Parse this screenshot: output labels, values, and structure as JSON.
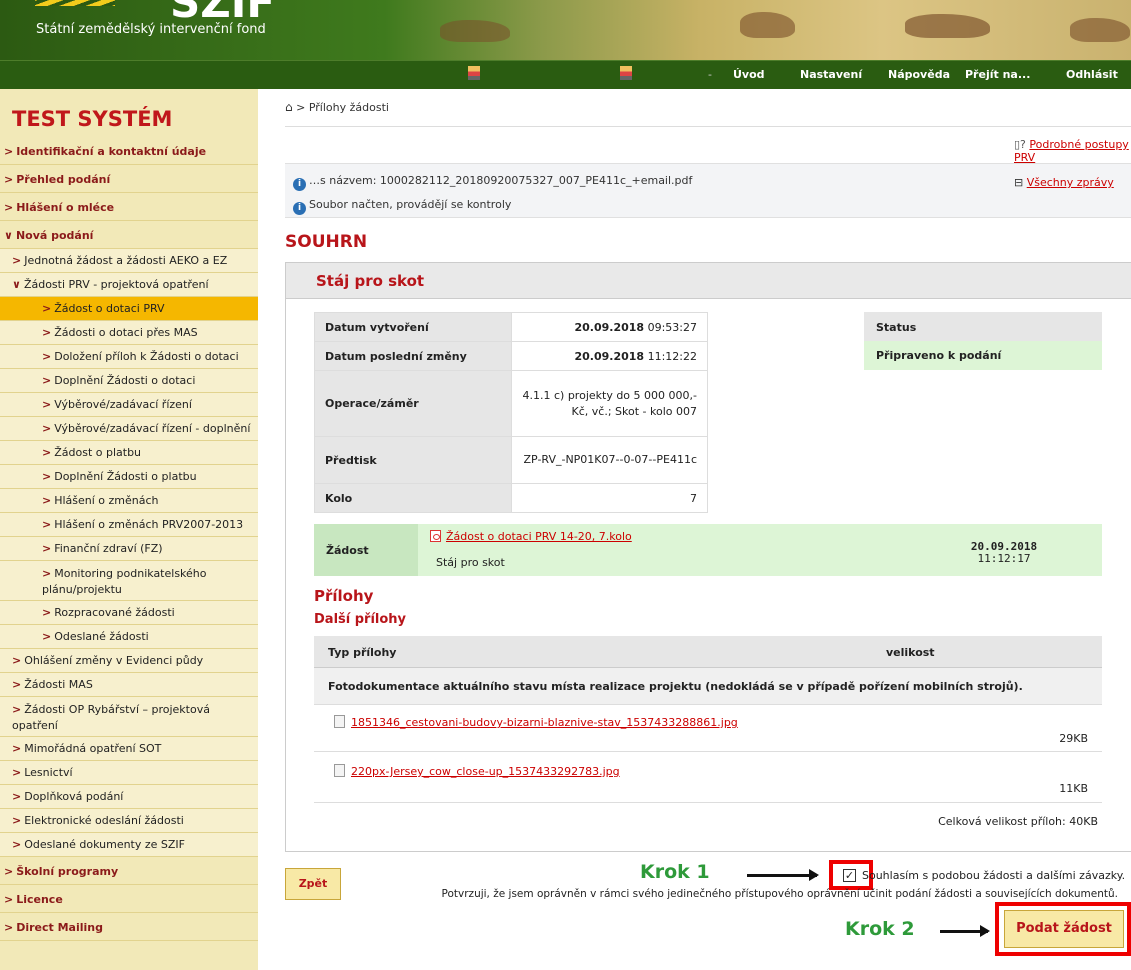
{
  "header": {
    "subtitle": "Státní zemědělský intervenční fond",
    "logo": "SZIF"
  },
  "nav": {
    "items": [
      "Úvod",
      "Nastavení",
      "Nápověda",
      "Přejít na...",
      "Odhlásit"
    ]
  },
  "sidebar": {
    "system_title": "TEST SYSTÉM",
    "items": [
      {
        "label": "Identifikační a kontaktní údaje",
        "level": 1,
        "arrow": ">"
      },
      {
        "label": "Přehled podání",
        "level": 1,
        "arrow": ">"
      },
      {
        "label": "Hlášení o mléce",
        "level": 1,
        "arrow": ">"
      },
      {
        "label": "Nová podání",
        "level": 1,
        "arrow": "∨"
      },
      {
        "label": "Jednotná žádost a žádosti AEKO a EZ",
        "level": 2,
        "arrow": ">"
      },
      {
        "label": "Žádosti PRV - projektová opatření",
        "level": 2,
        "arrow": "∨"
      },
      {
        "label": "Žádost o dotaci PRV",
        "level": 3,
        "arrow": ">",
        "active": true
      },
      {
        "label": "Žádosti o dotaci přes MAS",
        "level": 3,
        "arrow": ">"
      },
      {
        "label": "Doložení příloh k Žádosti o dotaci",
        "level": 3,
        "arrow": ">"
      },
      {
        "label": "Doplnění Žádosti o dotaci",
        "level": 3,
        "arrow": ">"
      },
      {
        "label": "Výběrové/zadávací řízení",
        "level": 3,
        "arrow": ">"
      },
      {
        "label": "Výběrové/zadávací řízení - doplnění",
        "level": 3,
        "arrow": ">"
      },
      {
        "label": "Žádost o platbu",
        "level": 3,
        "arrow": ">"
      },
      {
        "label": "Doplnění Žádosti o platbu",
        "level": 3,
        "arrow": ">"
      },
      {
        "label": "Hlášení o změnách",
        "level": 3,
        "arrow": ">"
      },
      {
        "label": "Hlášení o změnách PRV2007-2013",
        "level": 3,
        "arrow": ">"
      },
      {
        "label": "Finanční zdraví (FZ)",
        "level": 3,
        "arrow": ">"
      },
      {
        "label": "Monitoring podnikatelského plánu/projektu",
        "level": 3,
        "arrow": ">",
        "tall": true
      },
      {
        "label": "Rozpracované žádosti",
        "level": 3,
        "arrow": ">"
      },
      {
        "label": "Odeslané žádosti",
        "level": 3,
        "arrow": ">"
      },
      {
        "label": "Ohlášení změny v Evidenci půdy",
        "level": 2,
        "arrow": ">"
      },
      {
        "label": "Žádosti MAS",
        "level": 2,
        "arrow": ">"
      },
      {
        "label": "Žádosti OP Rybářství – projektová opatření",
        "level": 2,
        "arrow": ">",
        "tall": true
      },
      {
        "label": "Mimořádná opatření SOT",
        "level": 2,
        "arrow": ">"
      },
      {
        "label": "Lesnictví",
        "level": 2,
        "arrow": ">"
      },
      {
        "label": "Doplňková podání",
        "level": 2,
        "arrow": ">"
      },
      {
        "label": "Elektronické odeslání žádosti",
        "level": 2,
        "arrow": ">"
      },
      {
        "label": "Odeslané dokumenty ze SZIF",
        "level": 2,
        "arrow": ">"
      },
      {
        "label": "Školní programy",
        "level": 1,
        "arrow": ">"
      },
      {
        "label": "Licence",
        "level": 1,
        "arrow": ">"
      },
      {
        "label": "Direct Mailing",
        "level": 1,
        "arrow": ">"
      }
    ]
  },
  "breadcrumb": {
    "current": "Přílohy žádosti",
    "sep": ">"
  },
  "help_link": "Podrobné postupy PRV",
  "messages": [
    {
      "text": "…s názvem: 1000282112_20180920075327_007_PE411c_+email.pdf"
    },
    {
      "text": "Soubor načten, provádějí se kontroly"
    }
  ],
  "all_messages_link": "Všechny zprávy",
  "all_messages_icon": "⊟",
  "page_title": "SOUHRN",
  "panel_title": "Stáj pro skot",
  "details": [
    {
      "key": "Datum vytvoření",
      "value_bold": "20.09.2018",
      "value": " 09:53:27"
    },
    {
      "key": "Datum poslední změny",
      "value_bold": "20.09.2018",
      "value": " 11:12:22"
    },
    {
      "key": "Operace/záměr",
      "value": "4.1.1 c) projekty do 5 000 000,- Kč, vč.; Skot - kolo 007"
    },
    {
      "key": "Předtisk",
      "value": "ZP-RV_-NP01K07--0-07--PE411c"
    },
    {
      "key": "Kolo",
      "value": "7"
    }
  ],
  "status": {
    "header": "Status",
    "value": "Připraveno k podání"
  },
  "application": {
    "label": "Žádost",
    "link": "Žádost o dotaci PRV 14-20, 7.kolo",
    "sub": "Stáj pro skot",
    "date": "20.09.2018",
    "time": "11:12:17"
  },
  "attachments": {
    "title": "Přílohy",
    "subtitle": "Další přílohy",
    "col_type": "Typ přílohy",
    "col_size": "velikost",
    "group": "Fotodokumentace aktuálního stavu místa realizace projektu (nedokládá se v případě pořízení mobilních strojů).",
    "files": [
      {
        "name": "1851346_cestovani-budovy-bizarni-blaznive-stav_1537433288861.jpg",
        "size": "29KB"
      },
      {
        "name": "220px-Jersey_cow_close-up_1537433292783.jpg",
        "size": "11KB"
      }
    ],
    "total": "Celková velikost příloh: 40KB"
  },
  "back_button": "Zpět",
  "consent": {
    "checked": true,
    "line1": "Souhlasím s podobou žádosti a dalšími závazky.",
    "line2": "Potvrzuji, že jsem oprávněn v rámci svého jedinečného přístupového oprávnění učinit podání žádosti a souvisejících dokumentů."
  },
  "submit_button": "Podat žádost",
  "annotations": {
    "step1": "Krok 1",
    "step2": "Krok 2"
  },
  "colors": {
    "accent_red": "#b8151a",
    "nav_green": "#2a5c11",
    "sidebar": "#f2e9b8",
    "active": "#f5b700",
    "status_green": "#ddf5d6",
    "annotation_green": "#2e9a3a"
  }
}
